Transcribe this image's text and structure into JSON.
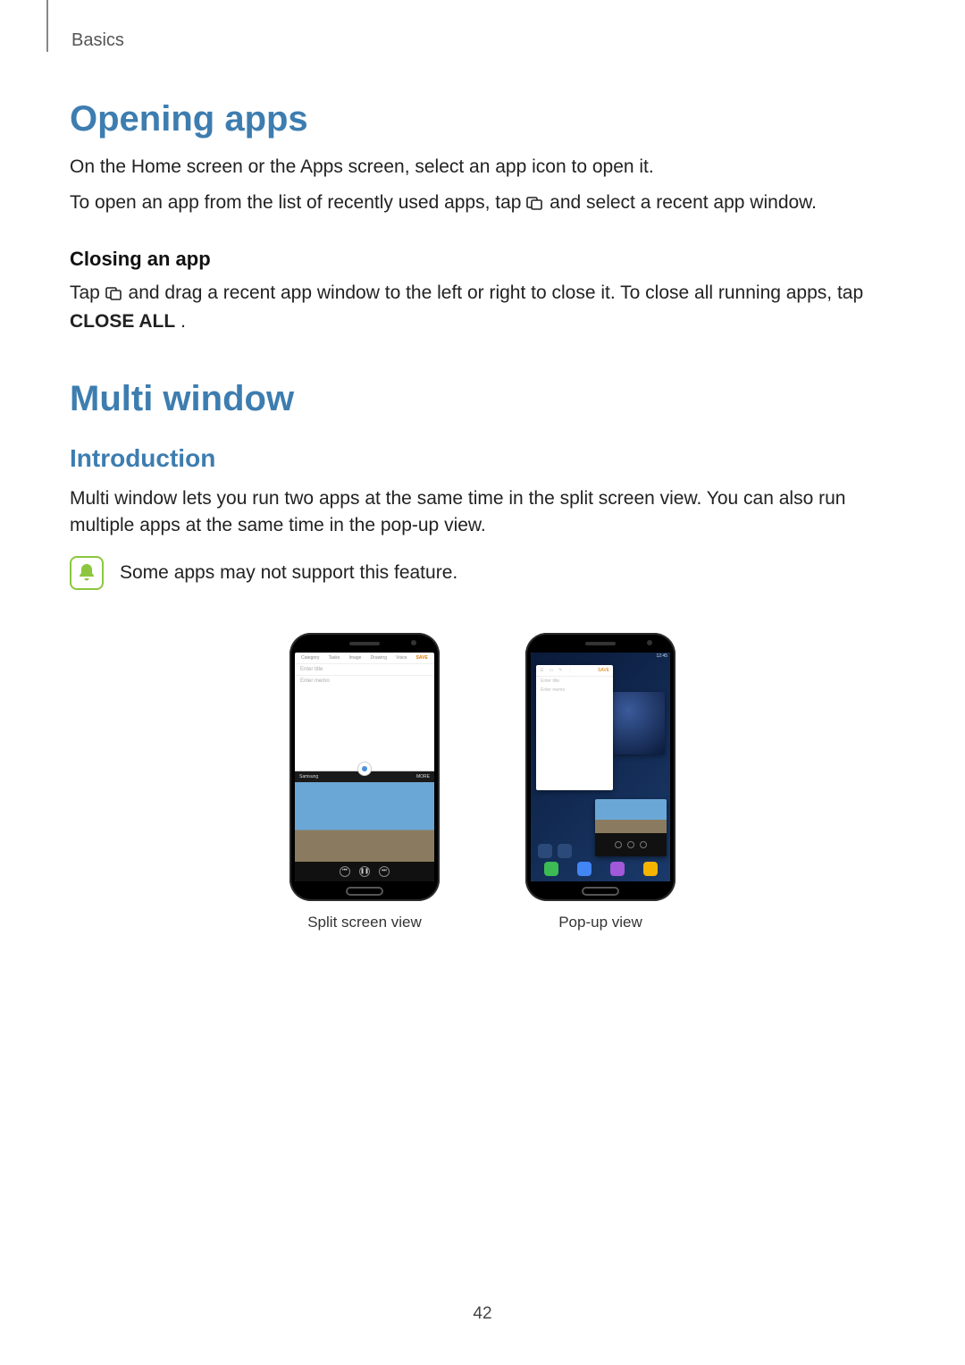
{
  "breadcrumb": "Basics",
  "section1": {
    "title": "Opening apps",
    "p1a": "On the Home screen or the Apps screen, select an app icon to open it.",
    "p2a": "To open an app from the list of recently used apps, tap ",
    "p2b": " and select a recent app window.",
    "sub": "Closing an app",
    "p3a": "Tap ",
    "p3b": " and drag a recent app window to the left or right to close it. To close all running apps, tap ",
    "p3c": "CLOSE ALL",
    "p3d": "."
  },
  "section2": {
    "title": "Multi window",
    "sub": "Introduction",
    "p1": "Multi window lets you run two apps at the same time in the split screen view. You can also run multiple apps at the same time in the pop-up view.",
    "note": "Some apps may not support this feature."
  },
  "figures": {
    "left_caption": "Split screen view",
    "right_caption": "Pop-up view",
    "split": {
      "toolbar": [
        "Category",
        "Tasks",
        "Image",
        "Drawing",
        "Voice"
      ],
      "save": "SAVE",
      "title_placeholder": "Enter title",
      "memo_placeholder": "Enter memo",
      "brand": "Samsung",
      "more": "MORE"
    },
    "popup": {
      "status_time": "12:45",
      "note_save": "SAVE",
      "note_title": "Enter title",
      "note_memo": "Enter memo",
      "dock": [
        "Phone",
        "Messages",
        "Internet",
        "Apps"
      ]
    }
  },
  "page_number": "42",
  "colors": {
    "heading": "#3d7db0",
    "note_border": "#8cc63f"
  }
}
